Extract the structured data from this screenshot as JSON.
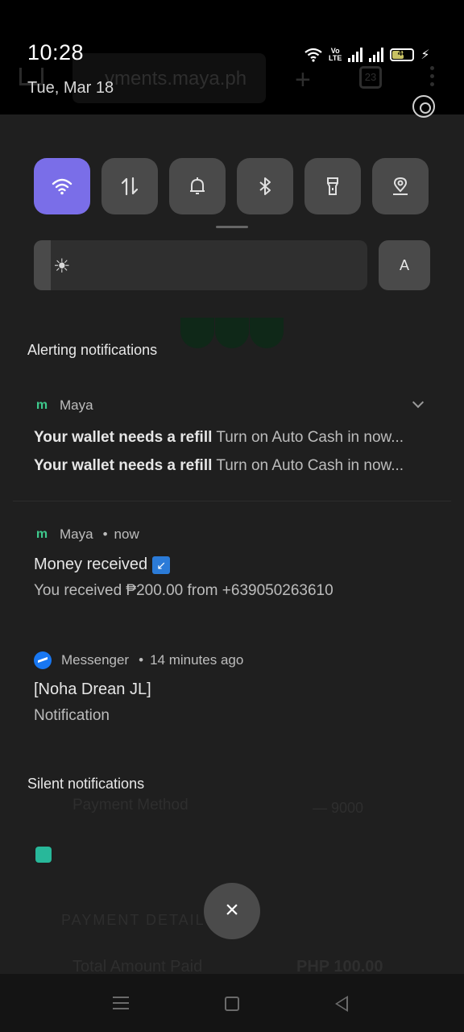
{
  "background_app": {
    "url_fragment": "yments.maya.ph",
    "tab_count": "23",
    "ghost_lines": {
      "payment_method": "Payment Method",
      "payment_method_value": "—  9000",
      "payment_details": "PAYMENT DETAILS",
      "total_amount_paid": "Total Amount Paid",
      "total_amount_value": "PHP 100.00"
    }
  },
  "status_bar": {
    "time": "10:28",
    "date": "Tue, Mar 18",
    "volte_label": "Vo\nLTE",
    "battery_level": "48"
  },
  "quick_settings": {
    "tiles": [
      {
        "name": "wifi",
        "icon": "wifi-icon",
        "active": true
      },
      {
        "name": "mobile-data",
        "icon": "data-arrows-icon",
        "active": false
      },
      {
        "name": "sound",
        "icon": "bell-icon",
        "active": false
      },
      {
        "name": "bluetooth",
        "icon": "bluetooth-icon",
        "active": false
      },
      {
        "name": "flashlight",
        "icon": "flashlight-icon",
        "active": false
      },
      {
        "name": "location",
        "icon": "location-icon",
        "active": false
      }
    ],
    "brightness_level": 0.05,
    "auto_brightness_label": "A"
  },
  "alerting": {
    "section_title": "Alerting notifications",
    "maya_group": {
      "app_name": "Maya",
      "lines": [
        {
          "title": "Your wallet needs a refill",
          "text": "Turn on Auto Cash in now..."
        },
        {
          "title": "Your wallet needs a refill",
          "text": "Turn on Auto Cash in now..."
        }
      ]
    },
    "maya_money": {
      "app_name": "Maya",
      "time": "now",
      "title": "Money received",
      "emoji": "↙",
      "text": "You received ₱200.00 from +639050263610"
    },
    "messenger": {
      "app_name": "Messenger",
      "time": "14 minutes ago",
      "title": "[Noha Drean JL]",
      "text": "Notification"
    }
  },
  "silent": {
    "section_title": "Silent notifications"
  },
  "clear_button": "×"
}
